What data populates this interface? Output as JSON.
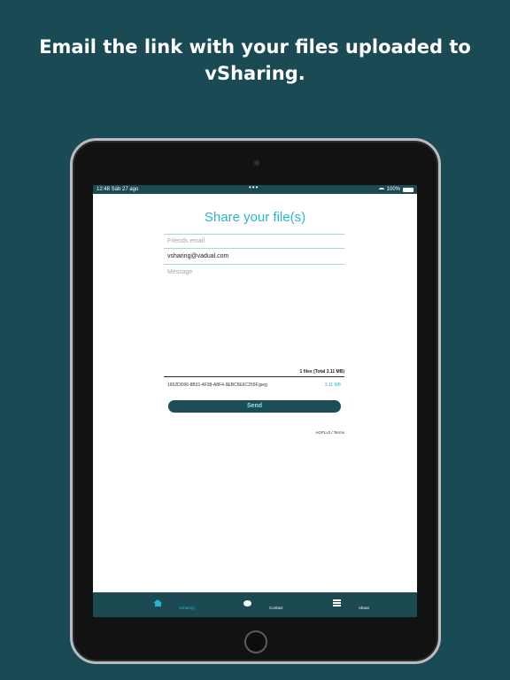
{
  "headline": "Email the link with your files uploaded to vSharing.",
  "status": {
    "time_date": "12:48  Sáb 27 ago",
    "dots": "•••",
    "battery": "100%"
  },
  "form": {
    "title": "Share your file(s)",
    "friends_email_placeholder": "Friends email",
    "sender_email": "vsharing@vadual.com",
    "message_placeholder": "Message"
  },
  "files": {
    "summary": "1 files (Total 3.11 MB)",
    "items": [
      {
        "name": "1652DD66-8B31-4F38-A8F4-9EBC5E6C255F.jpeg",
        "size": "3.11 MB"
      }
    ]
  },
  "send_label": "Send",
  "footer_link": "AGPLv3 / Terms",
  "tabs": [
    {
      "label": "vSharing",
      "icon": "home-icon"
    },
    {
      "label": "Contact",
      "icon": "chat-icon"
    },
    {
      "label": "About",
      "icon": "menu-icon"
    }
  ],
  "colors": {
    "background": "#1a4a54",
    "accent": "#2ab3cf",
    "bar": "#1c4a53"
  }
}
